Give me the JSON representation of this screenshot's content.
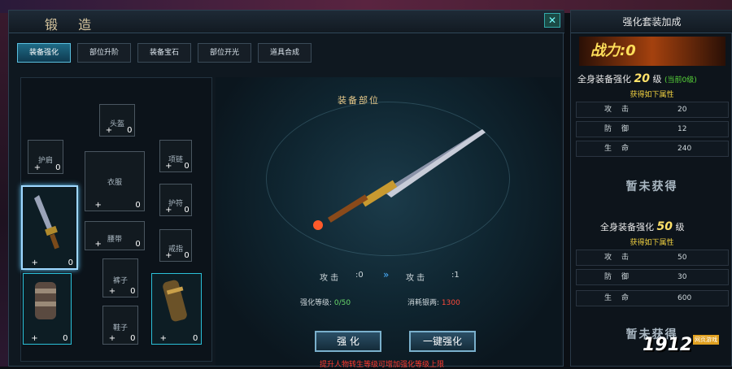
{
  "forge": {
    "title": "锻 造",
    "tabs": [
      "装备强化",
      "部位升阶",
      "装备宝石",
      "部位开光",
      "道具合成"
    ],
    "slots": [
      {
        "name": "头盔",
        "lv": "0"
      },
      {
        "name": "护肩",
        "lv": "0"
      },
      {
        "name": "衣服",
        "lv": "0"
      },
      {
        "name": "项链",
        "lv": "0"
      },
      {
        "name": "护符",
        "lv": "0"
      },
      {
        "name": "腰带",
        "lv": "0"
      },
      {
        "name": "戒指",
        "lv": "0"
      },
      {
        "name": "裤子",
        "lv": "0"
      },
      {
        "name": "鞋子",
        "lv": "0"
      },
      {
        "name": "",
        "lv": "0"
      },
      {
        "name": "",
        "lv": "0"
      },
      {
        "name": "",
        "lv": "0"
      }
    ],
    "plus_label": "+",
    "equip_head": "装备部位",
    "attack_label": "攻  击",
    "attack_current": ":0",
    "attack_next": ":1",
    "arrows": "»",
    "enhance_level_label": "强化等级:",
    "enhance_level_value": "0/50",
    "cost_label": "消耗银两:",
    "cost_value": "1300",
    "btn_enhance": "强 化",
    "btn_one_click": "一键强化",
    "tip": "提升人物转生等级可增加强化等级上限"
  },
  "right": {
    "title": "强化套装加成",
    "power_label": "战力:",
    "power_value": "0",
    "set1_label": "全身装备强化",
    "set1_level": "20",
    "set1_unit": "级",
    "set1_status": "(当前0级)",
    "set1_sub": "获得如下属性",
    "set1_stats": [
      {
        "k": "攻击",
        "v": "20"
      },
      {
        "k": "防御",
        "v": "12"
      },
      {
        "k": "生命",
        "v": "240"
      }
    ],
    "set1_unowned": "暂未获得",
    "set2_label": "全身装备强化",
    "set2_level": "50",
    "set2_unit": "级",
    "set2_sub": "获得如下属性",
    "set2_stats": [
      {
        "k": "攻击",
        "v": "50"
      },
      {
        "k": "防御",
        "v": "30"
      },
      {
        "k": "生命",
        "v": "600"
      }
    ],
    "set2_unowned": "暂未获得"
  },
  "logo": {
    "main": "1912",
    "sub": "网页游戏",
    "tag": "yx"
  },
  "colors": {
    "accent": "#2ac0d8",
    "gold": "#ffe26a",
    "warn": "#ff3a2e",
    "ok": "#68d86b"
  }
}
